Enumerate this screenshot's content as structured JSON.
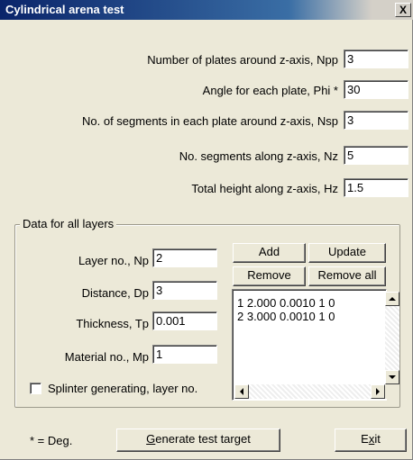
{
  "window": {
    "title": "Cylindrical arena test",
    "close_label": "X"
  },
  "fields": {
    "npp": {
      "label": "Number of plates around z-axis, Npp",
      "value": "3"
    },
    "phi": {
      "label": "Angle for each plate, Phi *",
      "value": "30"
    },
    "nsp": {
      "label": "No. of segments in each plate around z-axis, Nsp",
      "value": "3"
    },
    "nz": {
      "label": "No. segments along z-axis, Nz",
      "value": "5"
    },
    "hz": {
      "label": "Total height along z-axis, Hz",
      "value": "1.5"
    }
  },
  "layers": {
    "group_title": "Data for all layers",
    "np": {
      "label": "Layer no., Np",
      "value": "2"
    },
    "dp": {
      "label": "Distance, Dp",
      "value": "3"
    },
    "tp": {
      "label": "Thickness, Tp",
      "value": "0.001"
    },
    "mp": {
      "label": "Material no., Mp",
      "value": "1"
    },
    "splinter_label": "Splinter generating, layer no.",
    "splinter_checked": false,
    "buttons": {
      "add": "Add",
      "update": "Update",
      "remove": "Remove",
      "remove_all": "Remove all"
    },
    "list": [
      "1 2.000 0.0010 1 0",
      "2 3.000 0.0010 1 0"
    ]
  },
  "footer": {
    "note": "* = Deg.",
    "generate_prefix": "G",
    "generate_rest": "enerate test target",
    "exit_prefix": "E",
    "exit_underline": "x",
    "exit_rest": "it"
  }
}
